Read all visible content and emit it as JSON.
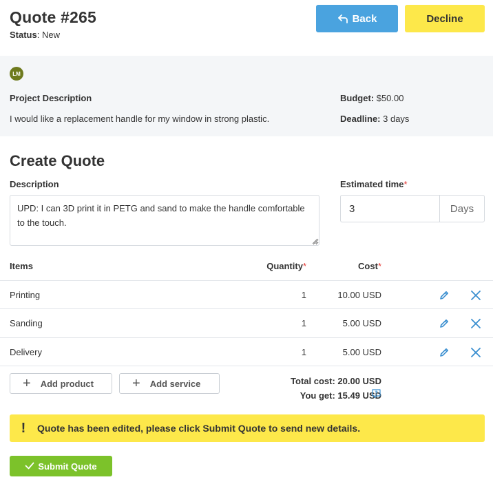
{
  "header": {
    "title": "Quote #265",
    "status_label": "Status",
    "status_value": ": New"
  },
  "actions": {
    "back_label": "Back",
    "decline_label": "Decline"
  },
  "project": {
    "avatar_initials": "LM",
    "description_label": "Project Description",
    "description_text": "I would like a replacement handle for my window in strong plastic.",
    "budget_label": "Budget:",
    "budget_value": " $50.00",
    "deadline_label": "Deadline:",
    "deadline_value": " 3 days"
  },
  "create_quote": {
    "title": "Create Quote",
    "description_label": "Description",
    "description_value": "UPD: I can 3D print it in PETG and sand to make the handle comfortable to the touch.",
    "estimated_time_label": "Estimated time",
    "required_mark": "*",
    "estimated_time_value": "3",
    "estimated_time_unit": "Days"
  },
  "table": {
    "headers": {
      "items": "Items",
      "quantity": "Quantity",
      "cost": "Cost"
    },
    "rows": [
      {
        "name": "Printing",
        "quantity": "1",
        "cost": "10.00 USD"
      },
      {
        "name": "Sanding",
        "quantity": "1",
        "cost": "5.00 USD"
      },
      {
        "name": "Delivery",
        "quantity": "1",
        "cost": "5.00 USD"
      }
    ]
  },
  "add_buttons": {
    "product_label": "Add product",
    "service_label": "Add service"
  },
  "totals": {
    "total_cost": "Total cost: 20.00 USD",
    "you_get": "You get: 15.49 USD"
  },
  "alert": {
    "icon": "!",
    "message": "Quote has been edited, please click Submit Quote to send new details."
  },
  "submit": {
    "label": "Submit Quote"
  },
  "icons": {
    "back": "arrow-back-icon",
    "edit": "pencil-icon",
    "delete": "close-icon",
    "add": "plus-icon",
    "help": "help-icon",
    "submit": "checkmark-icon"
  },
  "colors": {
    "primary_blue": "#4aa3df",
    "decline_yellow": "#fde84a",
    "alert_yellow": "#fde84a",
    "submit_green": "#7cc22a",
    "required_red": "#e53935",
    "avatar_olive": "#6e7a1e"
  }
}
